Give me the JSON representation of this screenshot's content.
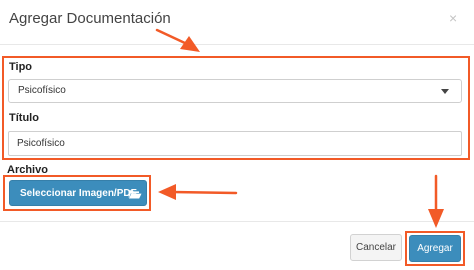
{
  "modal": {
    "title": "Agregar Documentación",
    "close_symbol": "×"
  },
  "form": {
    "tipo": {
      "label": "Tipo",
      "selected": "Psicofísico"
    },
    "titulo": {
      "label": "Título",
      "value": "Psicofísico"
    },
    "archivo": {
      "label": "Archivo",
      "button_label": "Seleccionar Imagen/PDF",
      "button_icon": "folder-open-icon"
    }
  },
  "footer": {
    "cancel_label": "Cancelar",
    "add_label": "Agregar"
  },
  "colors": {
    "primary": "#3c8dbc",
    "highlight": "#f25a27"
  }
}
